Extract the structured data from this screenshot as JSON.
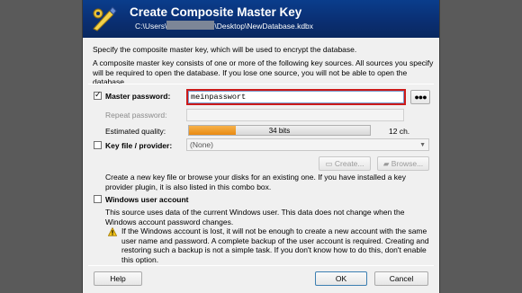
{
  "header": {
    "title": "Create Composite Master Key",
    "path_prefix": "C:\\Users\\",
    "path_suffix": "\\Desktop\\NewDatabase.kdbx",
    "colors": {
      "banner": "#0a2f73",
      "title": "#ffffff"
    }
  },
  "intro": {
    "line1": "Specify the composite master key, which will be used to encrypt the database.",
    "line2": "A composite master key consists of one or more of the following key sources. All sources you specify will be required to open the database.  If you lose one source, you will not be able to open the database."
  },
  "master_password": {
    "label": "Master password:",
    "checked": true,
    "value": "meinpasswort",
    "reveal_button": "●●●",
    "repeat_label": "Repeat password:",
    "quality_label": "Estimated quality:",
    "quality_text": "34 bits",
    "quality_fraction": 0.26,
    "char_count": "12 ch."
  },
  "key_file": {
    "label": "Key file / provider:",
    "checked": false,
    "selected": "(None)",
    "create_button": "Create...",
    "browse_button": "Browse...",
    "help": "Create a new key file or browse your disks for an existing one. If you have installed a key provider plugin, it is also listed in this combo box."
  },
  "windows_account": {
    "label": "Windows user account",
    "checked": false,
    "help": "This source uses data of the current Windows user. This data does not change when the Windows account password changes.",
    "warning": "If the Windows account is lost, it will not be enough to create a new account with the same user name and password. A complete backup of the user account is required. Creating and restoring such a backup is not a simple task. If you don't know how to do this, don't enable this option."
  },
  "footer": {
    "help_button": "Help",
    "ok_button": "OK",
    "cancel_button": "Cancel"
  }
}
